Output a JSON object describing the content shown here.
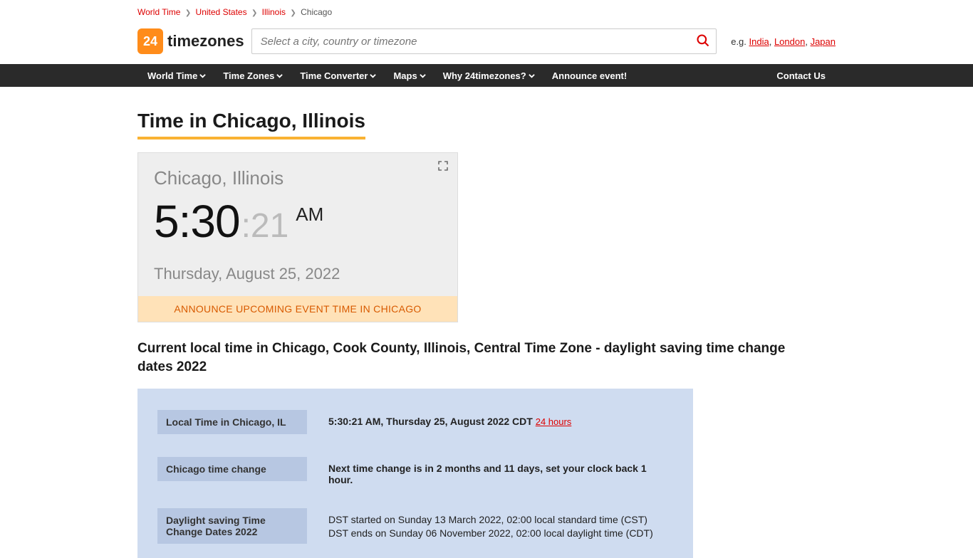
{
  "breadcrumb": {
    "items": [
      "World Time",
      "United States",
      "Illinois"
    ],
    "current": "Chicago"
  },
  "logo": {
    "box": "24",
    "text": "timezones"
  },
  "search": {
    "placeholder": "Select a city, country or timezone"
  },
  "eg": {
    "prefix": "e.g. ",
    "links": [
      "India",
      "London",
      "Japan"
    ]
  },
  "nav": {
    "items": [
      {
        "label": "World Time",
        "dd": true
      },
      {
        "label": "Time Zones",
        "dd": true
      },
      {
        "label": "Time Converter",
        "dd": true
      },
      {
        "label": "Maps",
        "dd": true
      },
      {
        "label": "Why 24timezones?",
        "dd": true
      },
      {
        "label": "Announce event!",
        "dd": false
      }
    ],
    "contact": "Contact Us"
  },
  "page_title": "Time in Chicago, Illinois",
  "clock": {
    "city": "Chicago, Illinois",
    "time_main": "5:30",
    "time_sec": ":21",
    "ampm": "AM",
    "date": "Thursday, August 25, 2022",
    "announce": "ANNOUNCE UPCOMING EVENT TIME IN CHICAGO"
  },
  "sub_heading": "Current local time in Chicago, Cook County, Illinois, Central Time Zone - daylight saving time change dates 2022",
  "info": {
    "rows": [
      {
        "label": "Local Time in Chicago, IL",
        "value_bold": "5:30:21 AM, Thursday 25, August 2022 CDT",
        "link": "24 hours"
      },
      {
        "label": "Chicago time change",
        "value_bold": "Next time change is in 2 months and 11 days, set your clock back 1 hour."
      },
      {
        "label": "Daylight saving Time Change Dates 2022",
        "lines": [
          "DST started on Sunday 13 March 2022, 02:00 local standard time (CST)",
          "DST ends on Sunday 06 November 2022, 02:00 local daylight time (CDT)"
        ]
      }
    ]
  }
}
